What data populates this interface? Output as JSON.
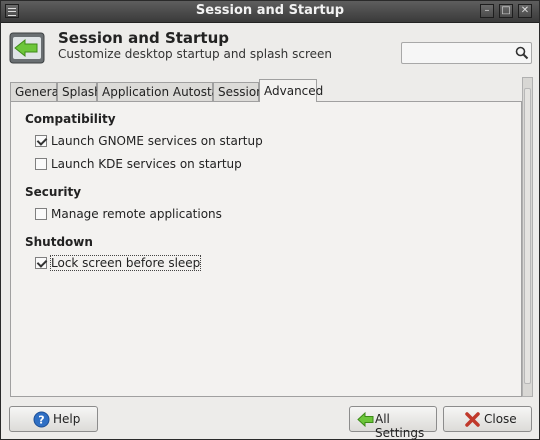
{
  "window": {
    "title": "Session and Startup",
    "controls": [
      "menu-icon",
      "minimize-icon",
      "maximize-icon",
      "close-icon"
    ]
  },
  "header": {
    "title": "Session and Startup",
    "subtitle": "Customize desktop startup and splash screen",
    "search": {
      "value": "",
      "placeholder": ""
    }
  },
  "tabs": [
    {
      "label": "General",
      "active": false
    },
    {
      "label": "Splash",
      "active": false
    },
    {
      "label": "Application Autostart",
      "active": false
    },
    {
      "label": "Session",
      "active": false
    },
    {
      "label": "Advanced",
      "active": true
    }
  ],
  "sections": {
    "compatibility": {
      "title": "Compatibility",
      "options": [
        {
          "label": "Launch GNOME services on startup",
          "checked": true
        },
        {
          "label": "Launch KDE services on startup",
          "checked": false
        }
      ]
    },
    "security": {
      "title": "Security",
      "options": [
        {
          "label": "Manage remote applications",
          "checked": false
        }
      ]
    },
    "shutdown": {
      "title": "Shutdown",
      "options": [
        {
          "label": "Lock screen before sleep",
          "checked": true
        }
      ]
    }
  },
  "buttons": {
    "help": "Help",
    "all_settings": "All Settings",
    "close": "Close"
  },
  "colors": {
    "titlebar": "#4a4a4a",
    "accent_green": "#6cc63a",
    "help_blue": "#2f6fc4",
    "close_red": "#c0392b"
  }
}
